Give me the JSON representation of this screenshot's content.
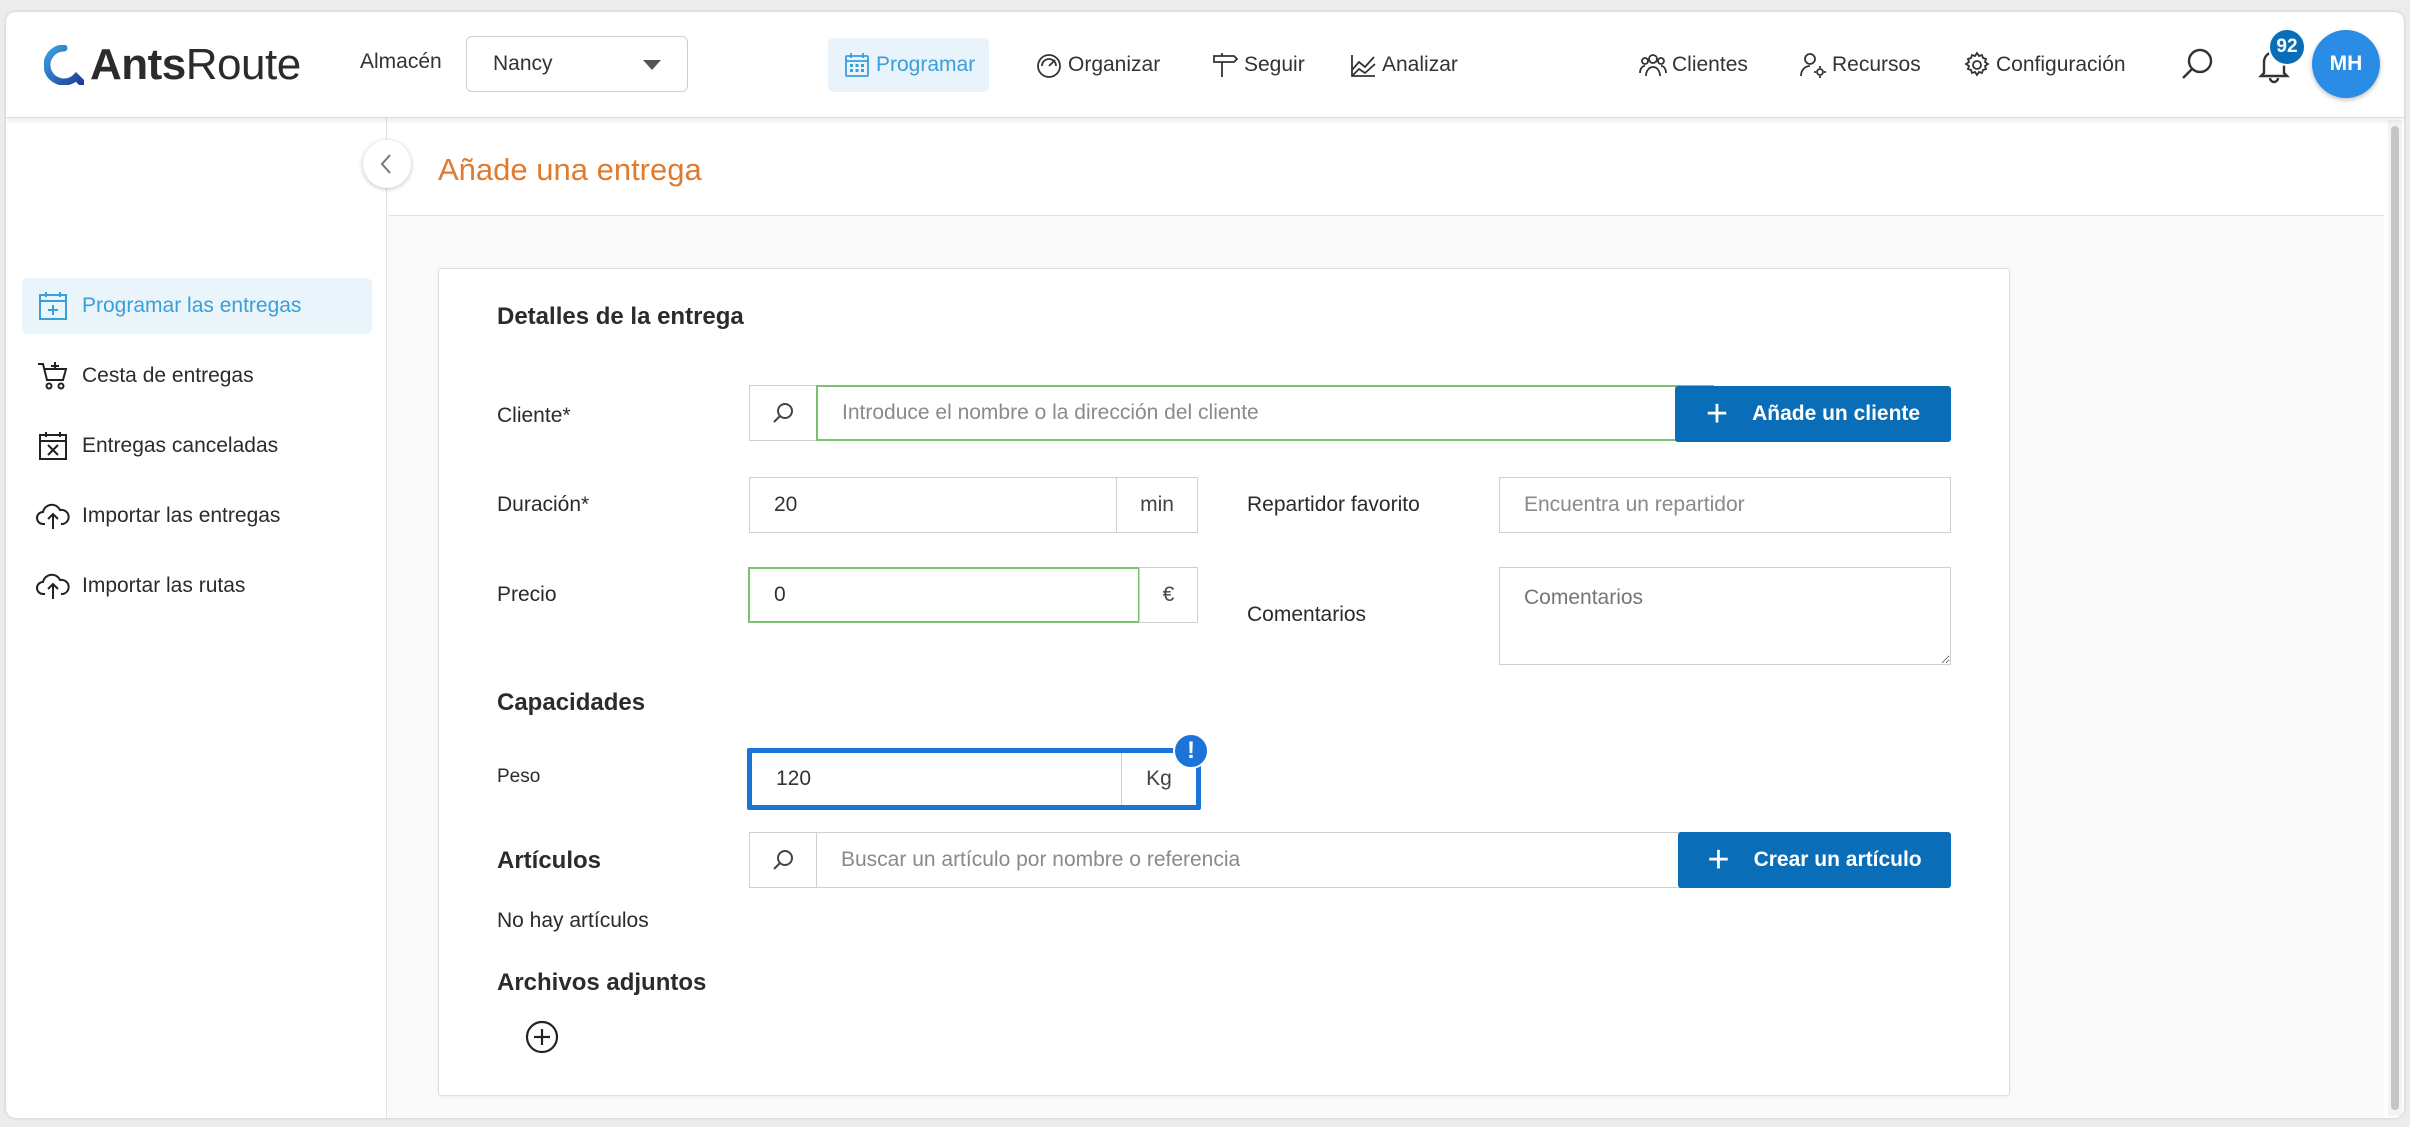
{
  "app": {
    "logo_bold": "Ants",
    "logo_light": "Route"
  },
  "header": {
    "warehouse_label": "Almacén",
    "warehouse_value": "Nancy",
    "nav": [
      {
        "label": "Programar",
        "icon": "calendar-icon",
        "active": true
      },
      {
        "label": "Organizar",
        "icon": "speedometer-icon"
      },
      {
        "label": "Seguir",
        "icon": "signpost-icon"
      },
      {
        "label": "Analizar",
        "icon": "chart-icon"
      },
      {
        "label": "Clientes",
        "icon": "people-icon"
      },
      {
        "label": "Recursos",
        "icon": "user-gear-icon"
      },
      {
        "label": "Configuración",
        "icon": "gear-icon"
      }
    ],
    "notifications_count": "92",
    "avatar_initials": "MH"
  },
  "sidebar": {
    "items": [
      {
        "label": "Programar las entregas",
        "icon": "calendar-plus-icon",
        "active": true
      },
      {
        "label": "Cesta de entregas",
        "icon": "cart-icon"
      },
      {
        "label": "Entregas canceladas",
        "icon": "calendar-x-icon"
      },
      {
        "label": "Importar las entregas",
        "icon": "cloud-upload-icon"
      },
      {
        "label": "Importar las rutas",
        "icon": "cloud-upload-icon"
      }
    ]
  },
  "page": {
    "title": "Añade una entrega"
  },
  "form": {
    "section_details": "Detalles de la entrega",
    "client_label": "Cliente*",
    "client_placeholder": "Introduce el nombre o la dirección del cliente",
    "add_client_button": "Añade un cliente",
    "duration_label": "Duración*",
    "duration_value": "20",
    "duration_unit": "min",
    "favorite_driver_label": "Repartidor favorito",
    "favorite_driver_placeholder": "Encuentra un repartidor",
    "price_label": "Precio",
    "price_value": "0",
    "price_unit": "€",
    "comments_label": "Comentarios",
    "comments_placeholder": "Comentarios",
    "section_capacities": "Capacidades",
    "weight_label": "Peso",
    "weight_value": "120",
    "weight_unit": "Kg",
    "weight_alert": "!",
    "section_articles": "Artículos",
    "article_placeholder": "Buscar un artículo por nombre o referencia",
    "create_article_button": "Crear un artículo",
    "no_articles": "No hay artículos",
    "section_attachments": "Archivos adjuntos"
  },
  "colors": {
    "primary": "#0a6db8",
    "accent": "#3a9fd8",
    "title": "#e07b2e",
    "valid": "#7cc16f",
    "focus": "#1d74d8"
  }
}
